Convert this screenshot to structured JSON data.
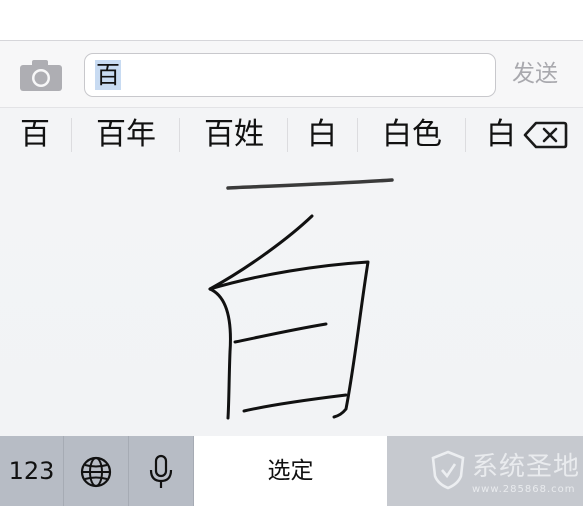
{
  "input_bar": {
    "camera_icon": "camera-icon",
    "field_value": "百",
    "send_label": "发送"
  },
  "candidates": [
    {
      "label": "百"
    },
    {
      "label": "百年"
    },
    {
      "label": "百姓"
    },
    {
      "label": "白"
    },
    {
      "label": "白色"
    },
    {
      "label": "白"
    }
  ],
  "delete_icon": "backspace-icon",
  "keyboard": {
    "numbers_label": "123",
    "globe_icon": "globe-icon",
    "mic_icon": "microphone-icon",
    "confirm_label": "选定"
  },
  "watermark": {
    "site_name": "系统圣地",
    "url": "www.285868.com"
  },
  "colors": {
    "selection": "#c8dbf2",
    "send_disabled": "#a9a9ae",
    "keyboard_key": "#b7bcc5"
  }
}
